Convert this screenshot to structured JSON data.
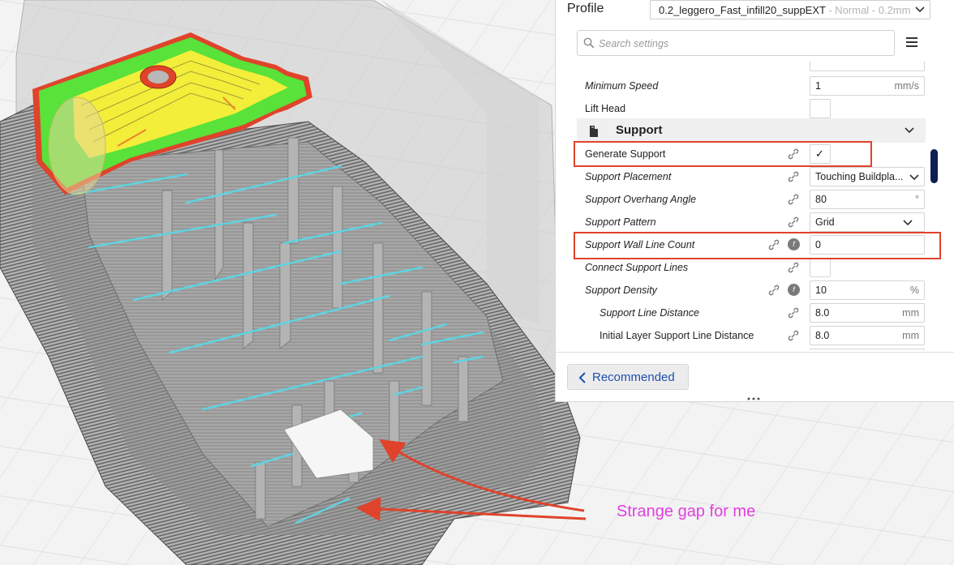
{
  "profile": {
    "label": "Profile",
    "name": "0.2_leggero_Fast_infill20_suppEXT",
    "suffix": " - Normal - 0.2mm"
  },
  "search": {
    "placeholder": "Search settings"
  },
  "settings_top": [
    {
      "label": "Minimum Speed",
      "value": "1",
      "unit": "mm/s"
    },
    {
      "label": "Lift Head",
      "value": ""
    }
  ],
  "support": {
    "category": "Support",
    "generate_support": {
      "label": "Generate Support",
      "checked": true,
      "check": "✓"
    },
    "placement": {
      "label": "Support Placement",
      "value": "Touching Buildpla..."
    },
    "overhang_angle": {
      "label": "Support Overhang Angle",
      "value": "80",
      "unit": "°"
    },
    "pattern": {
      "label": "Support Pattern",
      "value": "Grid"
    },
    "wall_line_count": {
      "label": "Support Wall Line Count",
      "value": "0"
    },
    "connect_lines": {
      "label": "Connect Support Lines",
      "value": ""
    },
    "density": {
      "label": "Support Density",
      "value": "10",
      "unit": "%"
    },
    "line_distance": {
      "label": "Support Line Distance",
      "value": "8.0",
      "unit": "mm"
    },
    "initial_line_distance": {
      "label": "Initial Layer Support Line Distance",
      "value": "8.0",
      "unit": "mm"
    }
  },
  "footer": {
    "recommended_label": "Recommended"
  },
  "annotation": {
    "text": "Strange gap for me"
  },
  "colors": {
    "accent_blue": "#1e4fb0",
    "highlight_red": "#e0432b",
    "annotation_magenta": "#e040e0",
    "scroll_thumb": "#0d1e52",
    "model_gray": "#8f8f8f",
    "support_cyan": "#5fd3e0",
    "top_yellow": "#f2ee3a",
    "top_green": "#58e23a"
  }
}
